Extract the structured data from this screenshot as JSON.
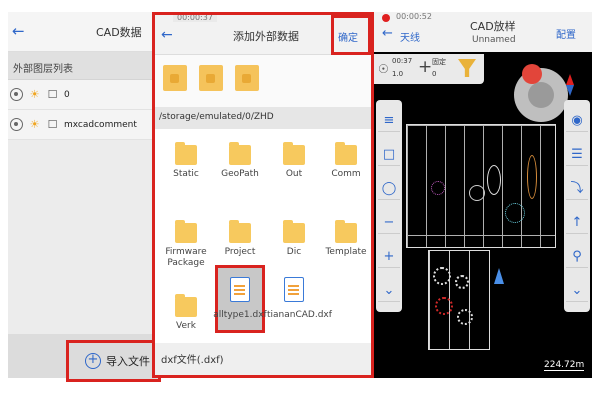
{
  "panel1": {
    "title": "CAD数据",
    "section": "外部图层列表",
    "layers": [
      {
        "name": "0"
      },
      {
        "name": "mxcadcomment"
      }
    ],
    "import_label": "导入文件"
  },
  "panel2": {
    "time": "00:00:37",
    "title": "添加外部数据",
    "confirm": "确定",
    "path": "/storage/emulated/0/ZHD",
    "items": [
      {
        "label": "Static"
      },
      {
        "label": "GeoPath"
      },
      {
        "label": "Out"
      },
      {
        "label": "Comm"
      },
      {
        "label": "Firmware Package"
      },
      {
        "label": "Project"
      },
      {
        "label": "Dic"
      },
      {
        "label": "Template"
      },
      {
        "label": "Verk"
      },
      {
        "label": "alltype1.dxf"
      },
      {
        "label": "tiananCAD.dxf"
      }
    ],
    "filter": "dxf文件(.dxf)"
  },
  "panel3": {
    "time": "00:00:52",
    "mode": "天线",
    "title": "CAD放样",
    "subtitle": "Unnamed",
    "config": "配置",
    "sat_count": "00:37",
    "sat_value": "1.0",
    "fix_label": "固定",
    "fix_value": "0",
    "scale": "224.72m"
  },
  "colors": {
    "highlight": "#d9231f",
    "accent": "#2f67c9",
    "folder": "#f7c95e"
  }
}
